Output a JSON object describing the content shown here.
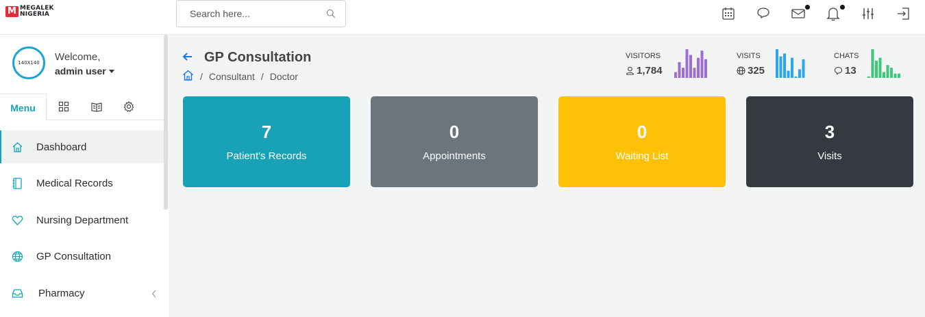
{
  "brand": {
    "mark": "M",
    "line1": "MEGALEK",
    "line2": "NIGERIA"
  },
  "search": {
    "placeholder": "Search here..."
  },
  "top_icons": [
    "calendar-icon",
    "chat-icon",
    "mail-icon",
    "bell-icon",
    "sliders-icon",
    "logout-icon"
  ],
  "user": {
    "avatar_text": "140X140",
    "welcome": "Welcome,",
    "name": "admin user"
  },
  "sidebar_tabs": {
    "menu": "Menu"
  },
  "nav": [
    {
      "label": "Dashboard",
      "icon": "home-icon"
    },
    {
      "label": "Medical Records",
      "icon": "notebook-icon"
    },
    {
      "label": "Nursing Department",
      "icon": "heart-icon"
    },
    {
      "label": "GP Consultation",
      "icon": "globe-icon"
    },
    {
      "label": "Pharmacy",
      "icon": "inbox-icon"
    }
  ],
  "page": {
    "title": "GP Consultation",
    "breadcrumb": [
      "Consultant",
      "Doctor"
    ]
  },
  "stats": [
    {
      "label": "VISITORS",
      "value": "1,784",
      "color": "#9b6fd6",
      "bars": [
        0.2,
        0.55,
        0.35,
        1.0,
        0.8,
        0.35,
        0.7,
        0.95,
        0.65
      ]
    },
    {
      "label": "VISITS",
      "value": "325",
      "color": "#2ea6ee",
      "bars": [
        1.0,
        0.75,
        0.85,
        0.25,
        0.7,
        0.05,
        0.3,
        0.65,
        0.3
      ]
    },
    {
      "label": "CHATS",
      "value": "13",
      "color": "#3ec97a",
      "bars": [
        0.05,
        1.0,
        0.6,
        0.7,
        0.2,
        0.45,
        0.35,
        0.15,
        0.15
      ]
    }
  ],
  "cards": [
    {
      "value": "7",
      "label": "Patient's Records",
      "color": "#17a2b8"
    },
    {
      "value": "0",
      "label": "Appointments",
      "color": "#6c757d"
    },
    {
      "value": "0",
      "label": "Waiting List",
      "color": "#ffc107"
    },
    {
      "value": "3",
      "label": "Visits",
      "color": "#343a40"
    }
  ]
}
